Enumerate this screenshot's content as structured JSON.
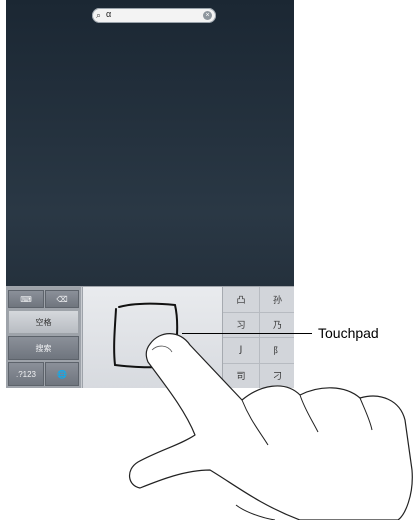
{
  "search": {
    "query": "α"
  },
  "keyboard": {
    "keys": {
      "hide": "⌨",
      "delete": "⌫",
      "space": "空格",
      "search": "搜索",
      "numbers": ".?123",
      "globe": "🌐"
    },
    "candidates": [
      "凸",
      "孙",
      "习",
      "乃",
      "J",
      "阝",
      "司",
      "刁"
    ]
  },
  "callout": {
    "label": "Touchpad"
  }
}
